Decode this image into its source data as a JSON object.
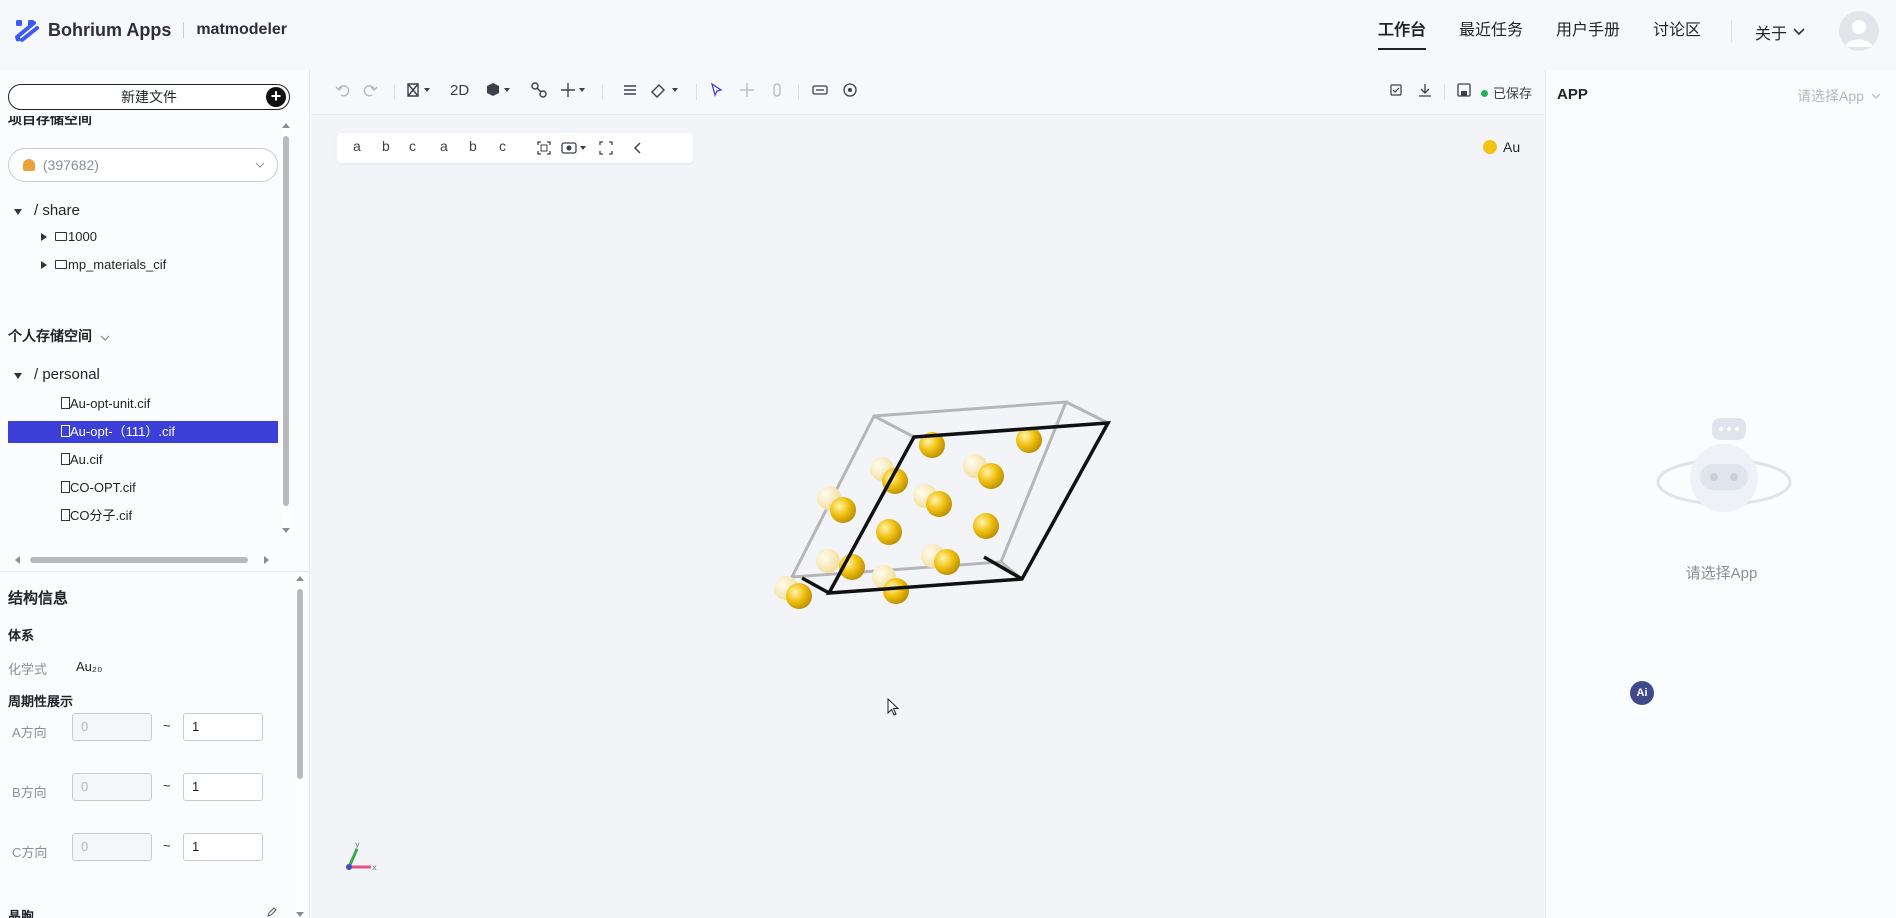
{
  "header": {
    "brand": "Bohrium Apps",
    "app_name": "matmodeler",
    "nav": [
      "工作台",
      "最近任务",
      "用户手册",
      "讨论区"
    ],
    "about": "关于",
    "colors": {
      "accent": "#3d3fd9",
      "brand_blue": "#3a5cf5"
    }
  },
  "sidebar": {
    "new_file": "新建文件",
    "project_storage": "项目存储空间",
    "project_select": "(397682)",
    "share_root": "/ share",
    "share_items": [
      "1000",
      "mp_materials_cif"
    ],
    "personal_storage": "个人存储空间",
    "personal_root": "/ personal",
    "personal_files": [
      "Au-opt-unit.cif",
      "Au-opt-（111）.cif",
      "Au.cif",
      "CO-OPT.cif",
      "CO分子.cif"
    ],
    "selected_file_index": 1
  },
  "structure": {
    "title": "结构信息",
    "system_label": "体系",
    "formula_label": "化学式",
    "formula": "Au₂₀",
    "periodic_label": "周期性展示",
    "axes": [
      {
        "label": "A方向",
        "from": "0",
        "to": "1"
      },
      {
        "label": "B方向",
        "from": "0",
        "to": "1"
      },
      {
        "label": "C方向",
        "from": "0",
        "to": "1"
      }
    ],
    "tilde": "~",
    "cell_label": "晶胞"
  },
  "toolbar": {
    "mode_2d": "2D",
    "saved": "已保存",
    "saved_color": "#22b35e"
  },
  "viewer": {
    "subtool_labels": [
      "a",
      "b",
      "c",
      "a",
      "b",
      "c"
    ],
    "legend_element": "Au",
    "atom_color": "#f2c313",
    "axis_labels": [
      "y",
      "x"
    ]
  },
  "right_panel": {
    "title": "APP",
    "select_app": "请选择App",
    "empty_text": "请选择App",
    "ai_badge": "Ai"
  }
}
